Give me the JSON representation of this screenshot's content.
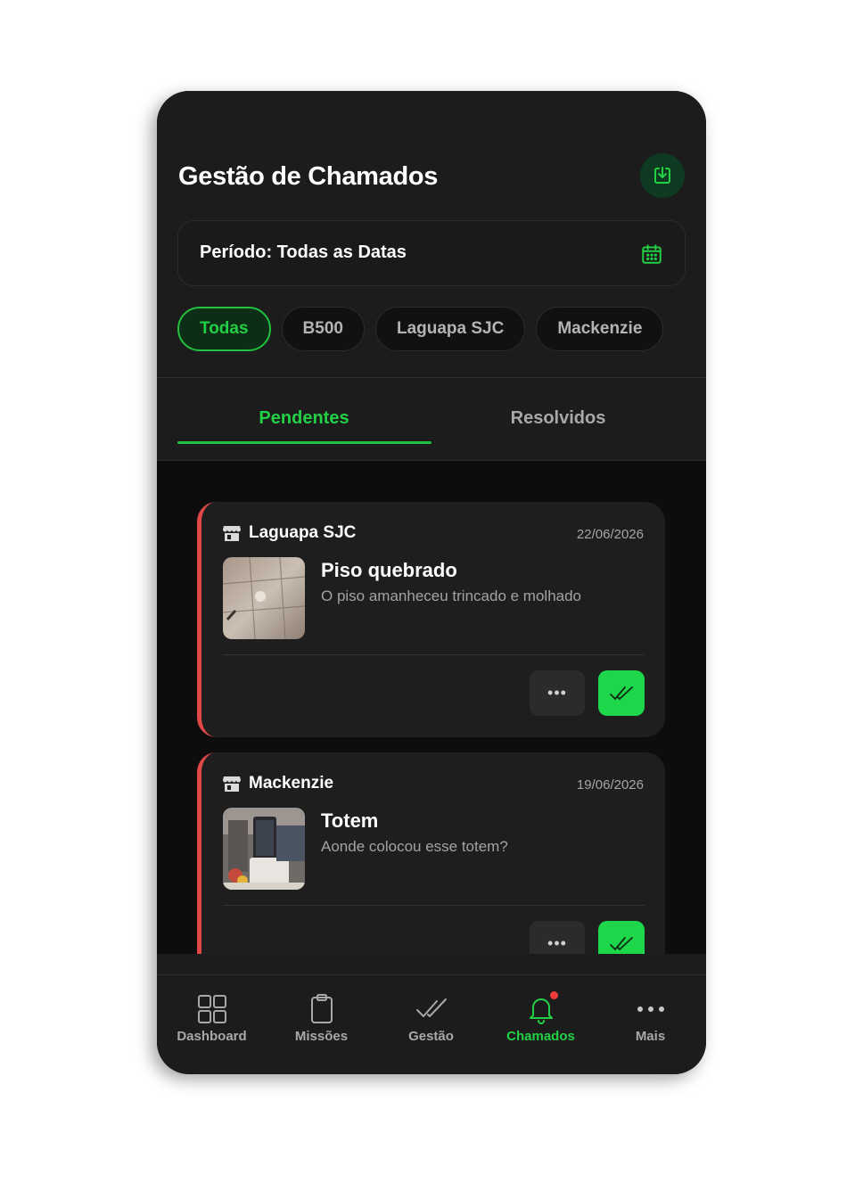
{
  "header": {
    "title": "Gestão de Chamados",
    "download_icon": "download-icon",
    "period_label": "Período: Todas as Datas",
    "calendar_icon": "calendar-icon"
  },
  "filters": {
    "chips": [
      {
        "label": "Todas",
        "active": true
      },
      {
        "label": "B500",
        "active": false
      },
      {
        "label": "Laguapa SJC",
        "active": false
      },
      {
        "label": "Mackenzie",
        "active": false
      }
    ]
  },
  "tabs": {
    "pendentes": "Pendentes",
    "resolvidos": "Resolvidos",
    "active": "Pendentes"
  },
  "tickets": [
    {
      "store": "Laguapa SJC",
      "date": "22/06/2026",
      "title": "Piso quebrado",
      "description": "O piso amanheceu trincado e molhado",
      "more_label": "•••"
    },
    {
      "store": "Mackenzie",
      "date": "19/06/2026",
      "title": "Totem",
      "description": "Aonde colocou esse totem?",
      "more_label": "•••"
    }
  ],
  "bottom_nav": {
    "items": [
      {
        "label": "Dashboard",
        "icon": "grid-icon"
      },
      {
        "label": "Missões",
        "icon": "clipboard-icon"
      },
      {
        "label": "Gestão",
        "icon": "double-check-icon"
      },
      {
        "label": "Chamados",
        "icon": "bell-icon",
        "active": true
      },
      {
        "label": "Mais",
        "icon": "more-dots-icon"
      }
    ]
  },
  "colors": {
    "accent_green": "#22d046",
    "alert_red": "#e04848",
    "background": "#1c1c1c"
  }
}
